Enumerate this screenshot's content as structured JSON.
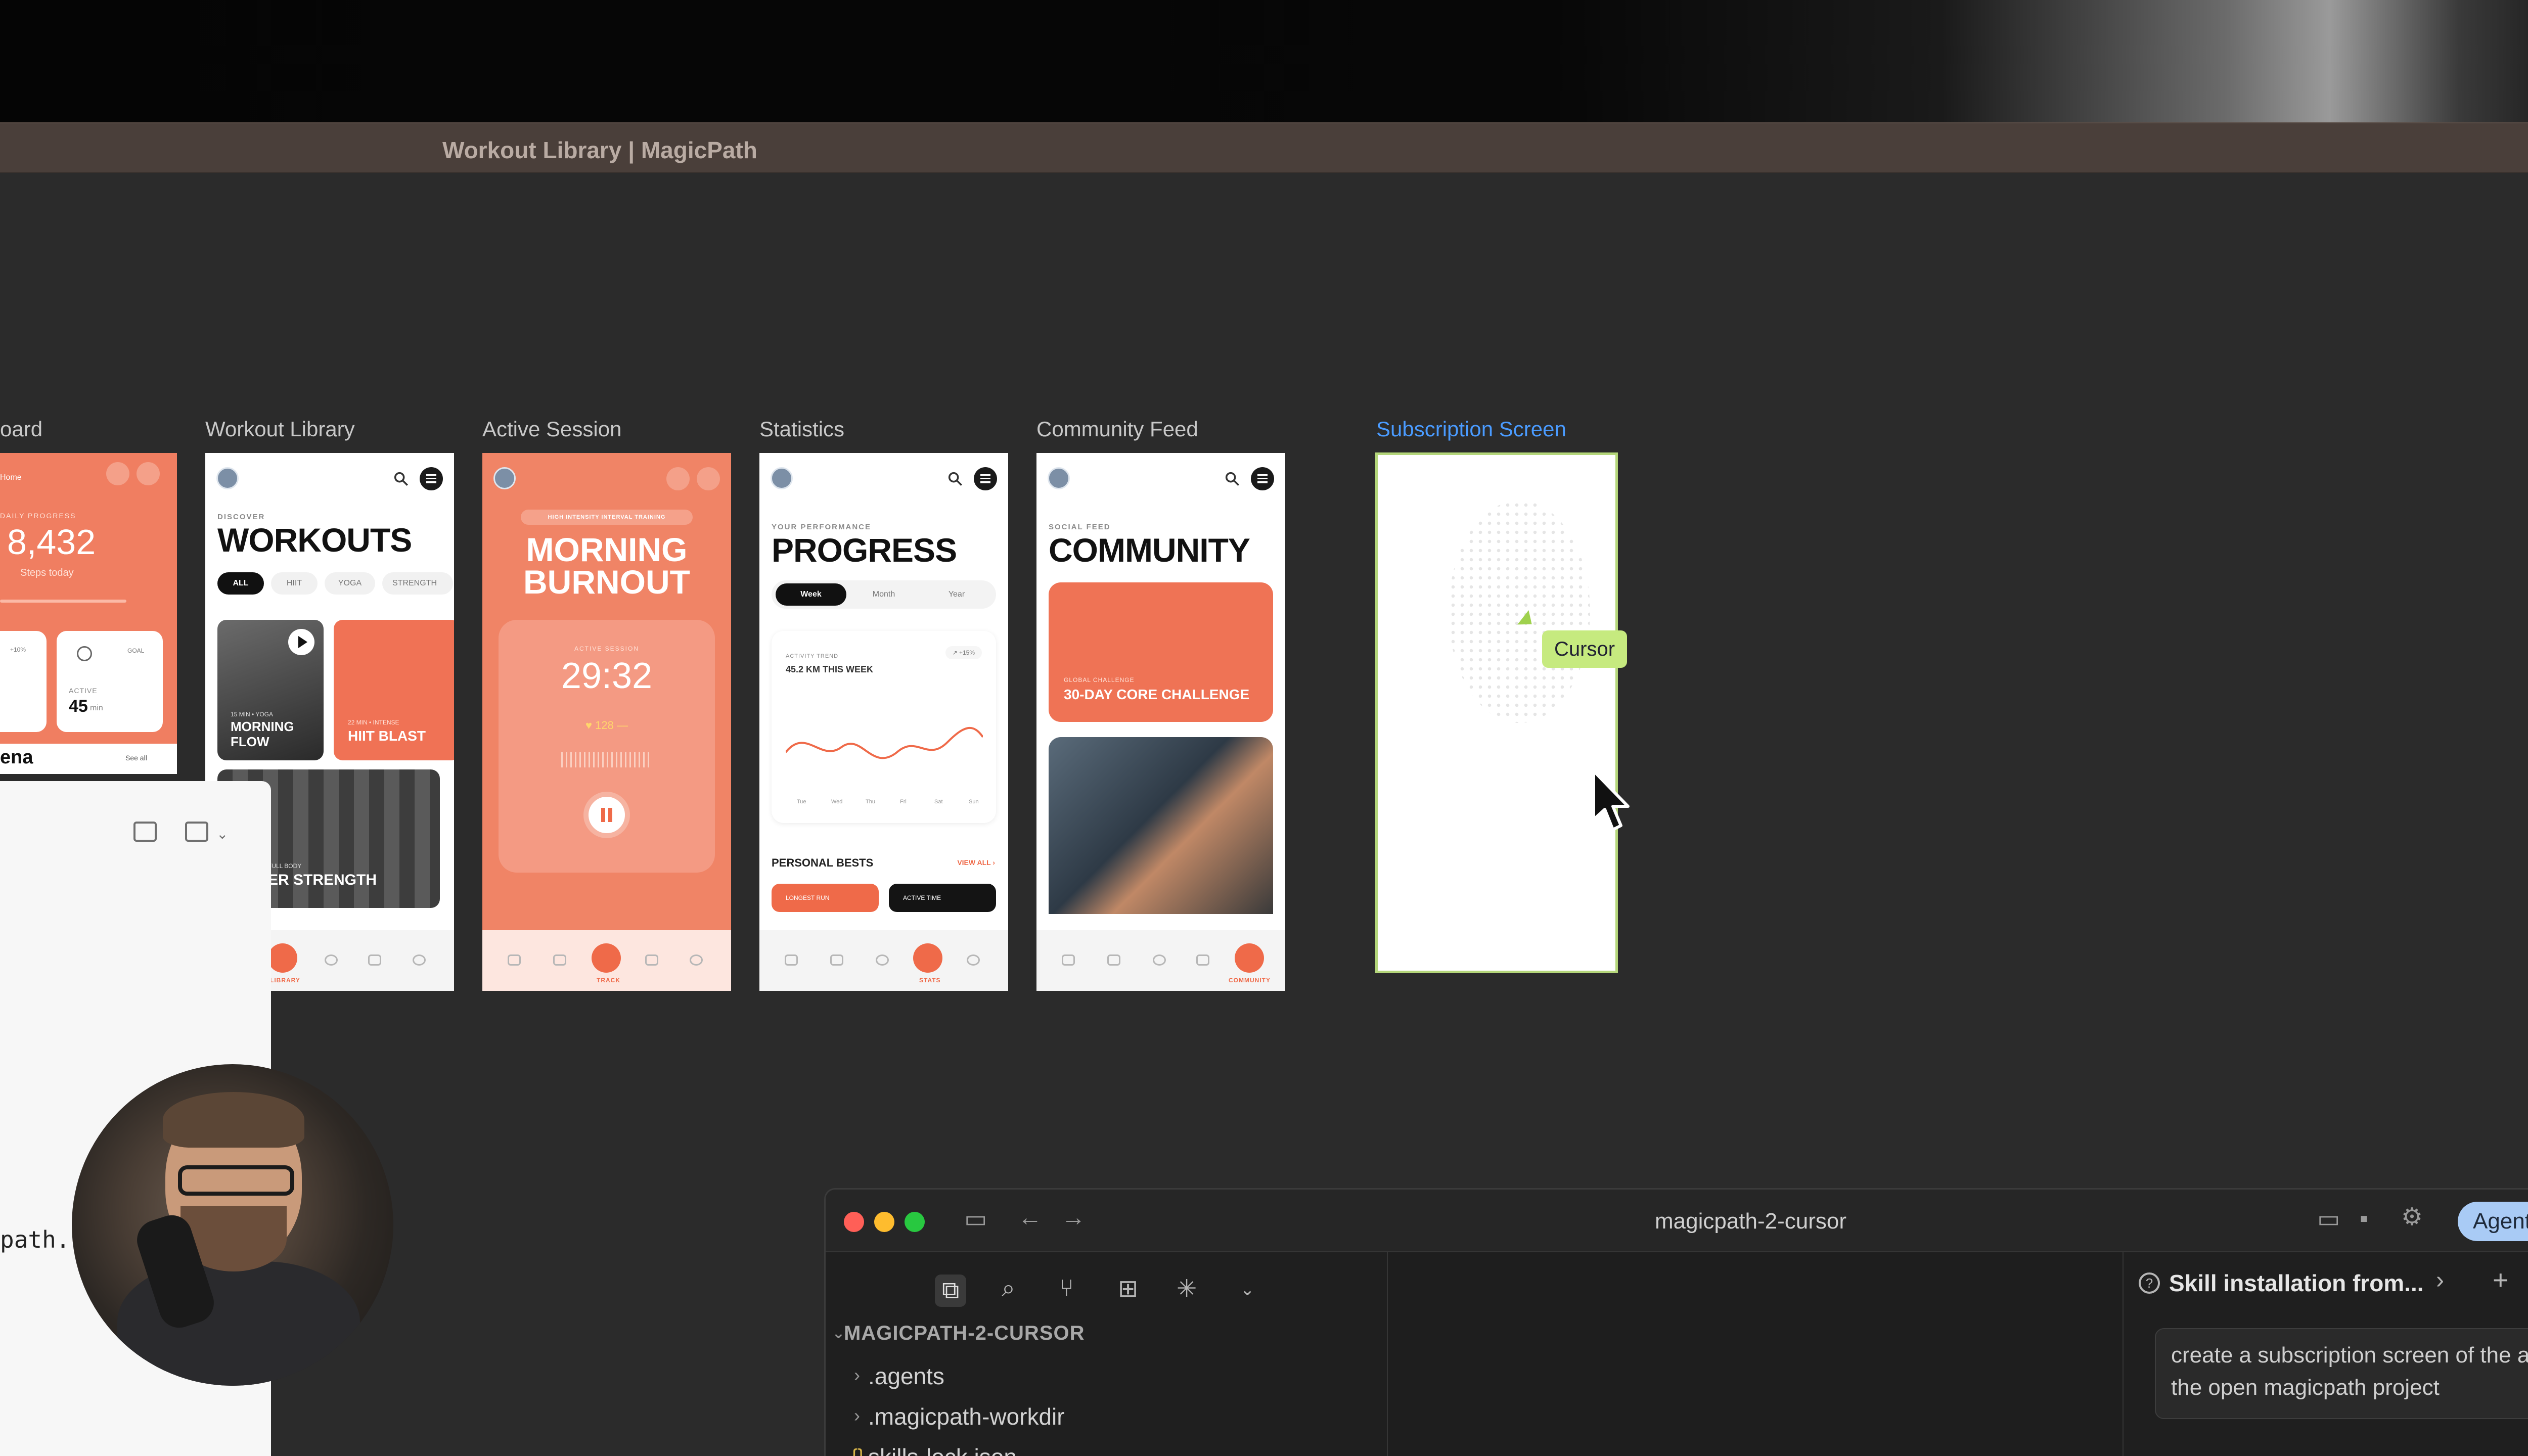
{
  "window": {
    "title": "Workout Library | MagicPath"
  },
  "frames": [
    {
      "label": "oard"
    },
    {
      "label": "Workout Library"
    },
    {
      "label": "Active Session"
    },
    {
      "label": "Statistics"
    },
    {
      "label": "Community Feed"
    },
    {
      "label": "Subscription Screen"
    }
  ],
  "dashboard": {
    "sub": "DAILY PROGRESS",
    "steps": "8,432",
    "steps_label": "Steps today",
    "active_label": "ACTIVE",
    "active_value": "45",
    "active_unit": "min",
    "goal": "GOAL",
    "pct": "+10%",
    "name_frag": "ena",
    "see_all": "See all",
    "home_frag": "Home"
  },
  "workouts": {
    "kicker": "DISCOVER",
    "title": "WORKOUTS",
    "chips": [
      "ALL",
      "HIIT",
      "YOGA",
      "STRENGTH"
    ],
    "card1": "MORNING FLOW",
    "card1_meta": "15 MIN • YOGA",
    "card2": "HIIT BLAST",
    "card2_meta": "22 MIN • INTENSE",
    "card3": "ER STRENGTH",
    "card3_meta": "FULL BODY",
    "tab_label": "LIBRARY"
  },
  "active": {
    "kicker": "HIGH INTENSITY INTERVAL TRAINING",
    "title_l1": "MORNING",
    "title_l2": "BURNOUT",
    "timer_label": "ACTIVE SESSION",
    "timer": "29:32",
    "bpm": "♥ 128 —",
    "tab_label": "TRACK"
  },
  "stats": {
    "kicker": "YOUR PERFORMANCE",
    "title": "PROGRESS",
    "segs": [
      "Week",
      "Month",
      "Year"
    ],
    "trend_label": "ACTIVITY TREND",
    "trend_value": "45.2 KM THIS WEEK",
    "trend_badge": "↗ +15%",
    "days": [
      "Tue",
      "Wed",
      "Thu",
      "Fri",
      "Sat",
      "Sun"
    ],
    "bests": "PERSONAL BESTS",
    "view_all": "VIEW ALL ›",
    "pb1": "LONGEST RUN",
    "pb2": "ACTIVE TIME",
    "tab_label": "STATS"
  },
  "community": {
    "kicker": "SOCIAL FEED",
    "title": "COMMUNITY",
    "challenge_kicker": "GLOBAL CHALLENGE",
    "challenge": "30-DAY CORE CHALLENGE",
    "tab_label": "COMMUNITY"
  },
  "subscription": {
    "cursor_tag": "Cursor"
  },
  "left_panel": {
    "code_fragment": "path."
  },
  "editor": {
    "title": "magicpath-2-cursor",
    "agents_button": "Agents Win",
    "project": "MAGICPATH-2-CURSOR",
    "tree": [
      ".agents",
      ".magicpath-workdir",
      "skills-lock.json"
    ],
    "chat_tab": "Skill installation from...",
    "prompt": "create a subscription screen of the app in the open magicpath project"
  }
}
